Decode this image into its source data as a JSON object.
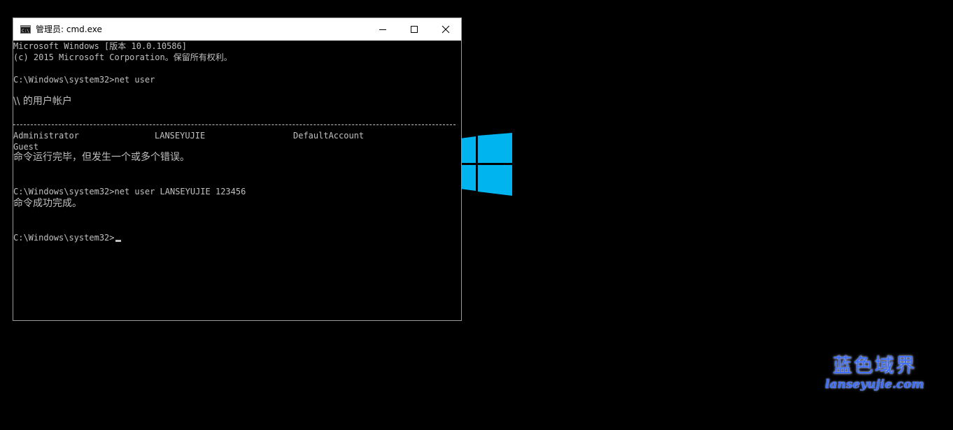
{
  "window": {
    "title": "管理员: cmd.exe",
    "minimize_label": "minimize",
    "maximize_label": "maximize",
    "close_label": "close"
  },
  "console": {
    "lines": {
      "l1": "Microsoft Windows [版本 10.0.10586]",
      "l2": "(c) 2015 Microsoft Corporation。保留所有权利。",
      "l3": "C:\\Windows\\system32>net user",
      "l4": "\\\\ 的用户帐户",
      "l5": "命令运行完毕，但发生一个或多个错误。",
      "l6": "C:\\Windows\\system32>net user LANSEYUJIE 123456",
      "l7": "命令成功完成。",
      "prompt": "C:\\Windows\\system32>"
    },
    "users": [
      "Administrator",
      "LANSEYUJIE",
      "DefaultAccount",
      "Guest"
    ]
  },
  "watermark": {
    "cn": "蓝色域界",
    "en": "lanseyujie.com"
  },
  "colors": {
    "console_bg": "#000000",
    "console_fg": "#c0c0c0",
    "windows_logo": "#00b4f0",
    "watermark": "#3b6dff"
  },
  "icons": {
    "app": "cmd-icon",
    "minimize": "minimize-icon",
    "maximize": "maximize-icon",
    "close": "close-icon",
    "logo": "windows-logo-icon"
  }
}
